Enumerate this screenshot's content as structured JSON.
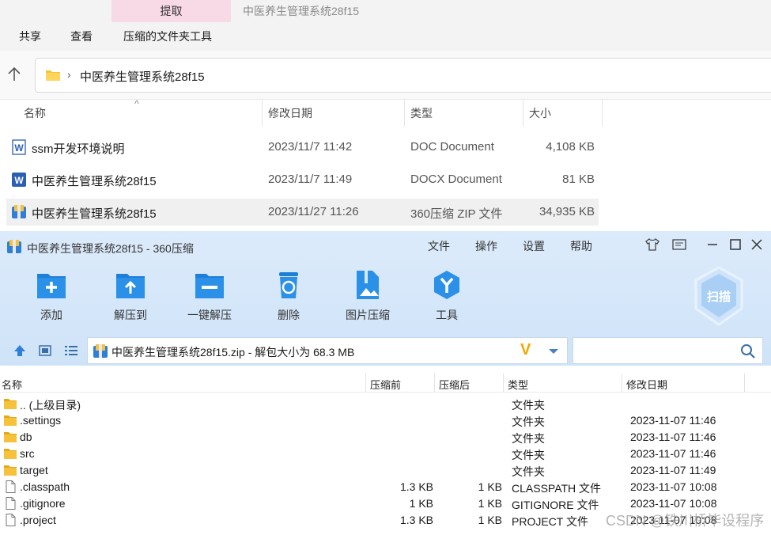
{
  "explorer": {
    "tab_extract": "提取",
    "window_title": "中医养生管理系统28f15",
    "menu": [
      "共享",
      "查看",
      "压缩的文件夹工具"
    ],
    "address": "中医养生管理系统28f15",
    "columns": {
      "name": "名称",
      "modified": "修改日期",
      "type": "类型",
      "size": "大小"
    },
    "files": [
      {
        "name": "ssm开发环境说明",
        "modified": "2023/11/7 11:42",
        "type": "DOC Document",
        "size": "4,108 KB",
        "icon": "word-doc-icon"
      },
      {
        "name": "中医养生管理系统28f15",
        "modified": "2023/11/7 11:49",
        "type": "DOCX Document",
        "size": "81 KB",
        "icon": "word-docx-icon"
      },
      {
        "name": "中医养生管理系统28f15",
        "modified": "2023/11/27 11:26",
        "type": "360压缩 ZIP 文件",
        "size": "34,935 KB",
        "icon": "zip-archive-icon"
      }
    ]
  },
  "zip": {
    "title": "中医养生管理系统28f15 - 360压缩",
    "menu": [
      "文件",
      "操作",
      "设置",
      "帮助"
    ],
    "tools": [
      "添加",
      "解压到",
      "一键解压",
      "删除",
      "图片压缩",
      "工具"
    ],
    "scan_label": "扫描",
    "path": "中医养生管理系统28f15.zip - 解包大小为 68.3 MB",
    "search_placeholder": "",
    "columns": {
      "name": "名称",
      "before": "压缩前",
      "after": "压缩后",
      "type": "类型",
      "modified": "修改日期"
    },
    "rows": [
      {
        "name": ".. (上级目录)",
        "before": "",
        "after": "",
        "type": "文件夹",
        "modified": "",
        "kind": "folder"
      },
      {
        "name": ".settings",
        "before": "",
        "after": "",
        "type": "文件夹",
        "modified": "2023-11-07 11:46",
        "kind": "folder"
      },
      {
        "name": "db",
        "before": "",
        "after": "",
        "type": "文件夹",
        "modified": "2023-11-07 11:46",
        "kind": "folder"
      },
      {
        "name": "src",
        "before": "",
        "after": "",
        "type": "文件夹",
        "modified": "2023-11-07 11:46",
        "kind": "folder"
      },
      {
        "name": "target",
        "before": "",
        "after": "",
        "type": "文件夹",
        "modified": "2023-11-07 11:49",
        "kind": "folder"
      },
      {
        "name": ".classpath",
        "before": "1.3 KB",
        "after": "1 KB",
        "type": "CLASSPATH 文件",
        "modified": "2023-11-07 10:08",
        "kind": "file"
      },
      {
        "name": ".gitignore",
        "before": "1 KB",
        "after": "1 KB",
        "type": "GITIGNORE 文件",
        "modified": "2023-11-07 10:08",
        "kind": "file"
      },
      {
        "name": ".project",
        "before": "1.3 KB",
        "after": "1 KB",
        "type": "PROJECT 文件",
        "modified": "2023-11-07 10:08",
        "kind": "file"
      }
    ]
  },
  "watermark": "CSDN @铁川桥毕设程序",
  "colors": {
    "accent": "#1e7fd8",
    "zip_bg": "#d8e8fa",
    "tab_pink": "#f8d9e6",
    "folder": "#f7c23b"
  }
}
